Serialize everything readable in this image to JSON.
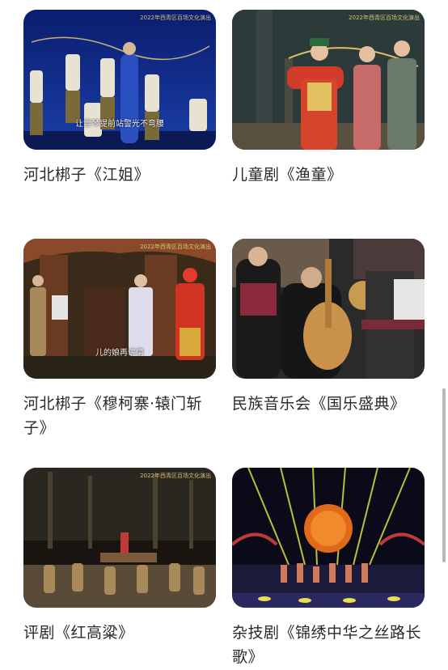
{
  "watermark": "2022年西青区百场文化演出",
  "items": [
    {
      "title": "河北梆子《江姐》",
      "subtitle": "让雪琴提前站警光不弯腰"
    },
    {
      "title": "儿童剧《渔童》"
    },
    {
      "title": "河北梆子《穆柯寨·辕门斩子》",
      "subtitle": "儿的娘再讲情"
    },
    {
      "title": "民族音乐会《国乐盛典》"
    },
    {
      "title": "评剧《红高粱》"
    },
    {
      "title": "杂技剧《锦绣中华之丝路长歌》"
    }
  ]
}
